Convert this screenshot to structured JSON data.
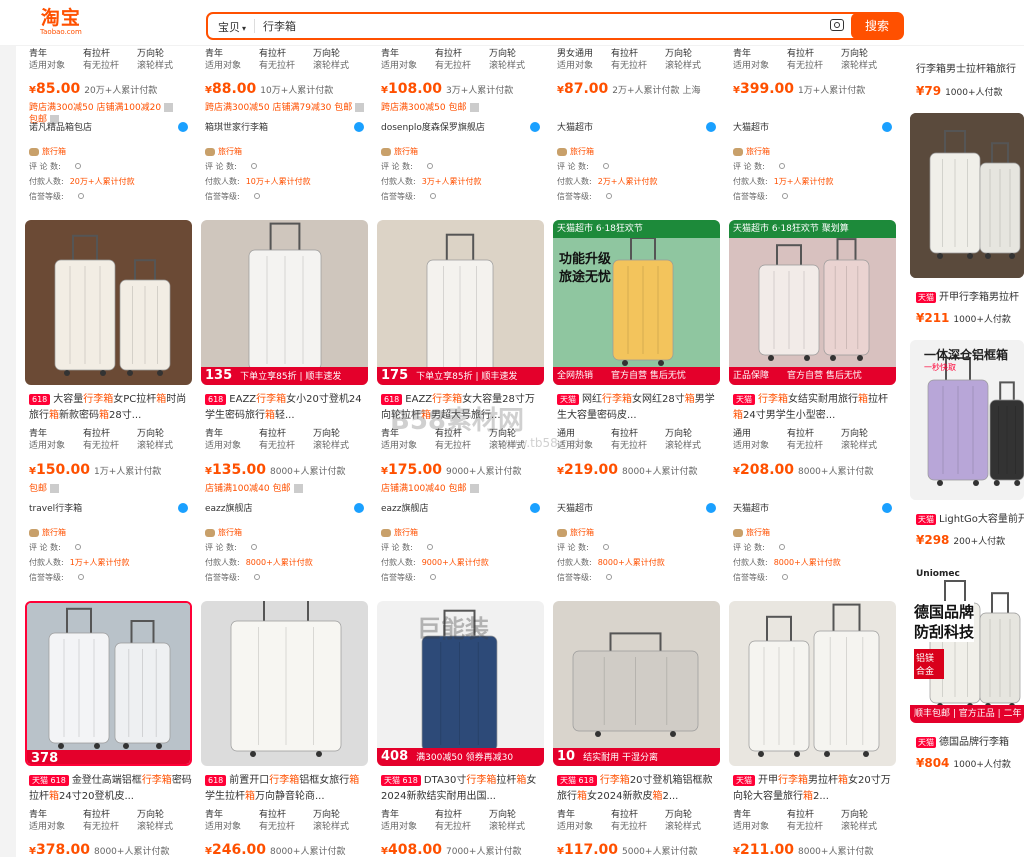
{
  "header": {
    "logo_cn": "淘宝",
    "logo_en": "Taobao.com",
    "scope": "宝贝",
    "query": "行李箱",
    "search_button": "搜索"
  },
  "labels": {
    "comments": "评 论 数:",
    "payers": "付款人数:",
    "credit": "信誉等级:",
    "travel_tag": "旅行箱"
  },
  "row1": [
    {
      "attrs": [
        "青年",
        "有拉杆",
        "万向轮"
      ],
      "keys": [
        "适用对象",
        "有无拉杆",
        "滚轮样式"
      ],
      "price": "85.00",
      "sales": "20万+人累计付款",
      "coupon": "跨店满300减50 店铺满100减20",
      "coupon2": "包邮",
      "shop": "诺凡精品箱包店",
      "payers": "20万+人累计付款"
    },
    {
      "attrs": [
        "青年",
        "有拉杆",
        "万向轮"
      ],
      "keys": [
        "适用对象",
        "有无拉杆",
        "滚轮样式"
      ],
      "price": "88.00",
      "sales": "10万+人累计付款",
      "coupon": "跨店满300减50 店铺满79减30 包邮",
      "coupon2": "",
      "shop": "箱琪世家行李箱",
      "payers": "10万+人累计付款"
    },
    {
      "attrs": [
        "青年",
        "有拉杆",
        "万向轮"
      ],
      "keys": [
        "适用对象",
        "有无拉杆",
        "滚轮样式"
      ],
      "price": "108.00",
      "sales": "3万+人累计付款",
      "coupon": "跨店满300减50 包邮",
      "coupon2": "",
      "shop": "dosenplo度森保罗旗舰店",
      "payers": "3万+人累计付款"
    },
    {
      "attrs": [
        "男女通用",
        "有拉杆",
        "万向轮"
      ],
      "keys": [
        "适用对象",
        "有无拉杆",
        "滚轮样式"
      ],
      "price": "87.00",
      "sales": "2万+人累计付款",
      "loc": "上海",
      "coupon": "",
      "coupon2": "",
      "shop": "大猫超市",
      "payers": "2万+人累计付款"
    },
    {
      "attrs": [
        "青年",
        "有拉杆",
        "万向轮"
      ],
      "keys": [
        "适用对象",
        "有无拉杆",
        "滚轮样式"
      ],
      "price": "399.00",
      "sales": "1万+人累计付款",
      "coupon": "",
      "coupon2": "",
      "shop": "大猫超市",
      "payers": "1万+人累计付款"
    }
  ],
  "row2": [
    {
      "badge": "618",
      "title_parts": [
        "大容量",
        "行李箱",
        "女PC拉杆",
        "箱",
        "时尚旅行",
        "箱",
        "新款密码",
        "箱",
        "28寸..."
      ],
      "attrs": [
        "青年",
        "有拉杆",
        "万向轮"
      ],
      "keys": [
        "适用对象",
        "有无拉杆",
        "滚轮样式"
      ],
      "price": "150.00",
      "sales": "1万+人累计付款",
      "coupon": "包邮",
      "shop": "travel行李箱",
      "payers": "1万+人累计付款"
    },
    {
      "badge": "618",
      "title_parts": [
        "EAZZ",
        "行李箱",
        "女小20寸登机24学生密码旅行",
        "箱",
        "轻..."
      ],
      "attrs": [
        "青年",
        "有拉杆",
        "万向轮"
      ],
      "keys": [
        "适用对象",
        "有无拉杆",
        "滚轮样式"
      ],
      "price": "135.00",
      "sales": "8000+人累计付款",
      "coupon": "店铺满100减40 包邮",
      "shop": "eazz旗舰店",
      "payers": "8000+人累计付款",
      "promo_price": "135",
      "promo_text": "下单立享85折 | 顺丰速发"
    },
    {
      "badge": "618",
      "title_parts": [
        "EAZZ",
        "行李箱",
        "女大容量28寸万向轮拉杆",
        "箱",
        "男超大号旅行..."
      ],
      "attrs": [
        "青年",
        "有拉杆",
        "万向轮"
      ],
      "keys": [
        "适用对象",
        "有无拉杆",
        "滚轮样式"
      ],
      "price": "175.00",
      "sales": "9000+人累计付款",
      "coupon": "店铺满100减40 包邮",
      "shop": "eazz旗舰店",
      "payers": "9000+人累计付款",
      "promo_price": "175",
      "promo_text": "下单立享85折 | 顺丰速发"
    },
    {
      "badge": "天猫",
      "title_parts": [
        "网红",
        "行李箱",
        "女网红28寸",
        "箱",
        "男学生大容量密码皮..."
      ],
      "attrs": [
        "通用",
        "有拉杆",
        "万向轮"
      ],
      "keys": [
        "适用对象",
        "有无拉杆",
        "滚轮样式"
      ],
      "price": "219.00",
      "sales": "8000+人累计付款",
      "coupon": "",
      "shop": "天猫超市",
      "payers": "8000+人累计付款",
      "banner": "天猫超市 6·18狂欢节",
      "promo1": "功能升级",
      "promo2": "旅途无忧",
      "promo3": "全网热销",
      "promo4": "官方自营 售后无忧"
    },
    {
      "badge": "天猫",
      "title_parts": [
        "行李箱",
        "女结实耐用旅行",
        "箱",
        "拉杆",
        "箱",
        "24寸男学生小型密..."
      ],
      "attrs": [
        "通用",
        "有拉杆",
        "万向轮"
      ],
      "keys": [
        "适用对象",
        "有无拉杆",
        "滚轮样式"
      ],
      "price": "208.00",
      "sales": "8000+人累计付款",
      "coupon": "",
      "shop": "天猫超市",
      "payers": "8000+人累计付款",
      "banner": "天猫超市 6·18狂欢节 聚划算",
      "promo3": "正品保障",
      "promo4": "官方自营 售后无忧"
    }
  ],
  "row3": [
    {
      "badge": "天猫 618",
      "title_parts": [
        "金登仕高端铝框",
        "行李箱",
        "密码拉杆",
        "箱",
        "24寸20登机皮..."
      ],
      "attrs": [
        "青年",
        "有拉杆",
        "万向轮"
      ],
      "keys": [
        "适用对象",
        "有无拉杆",
        "滚轮样式"
      ],
      "price": "378.00",
      "sales": "8000+人累计付款",
      "promo": "378"
    },
    {
      "badge": "618",
      "title_parts": [
        "前置开口",
        "行李箱",
        "铝框女旅行",
        "箱",
        "学生拉杆",
        "箱",
        "万向静音轮商..."
      ],
      "attrs": [
        "青年",
        "有拉杆",
        "万向轮"
      ],
      "keys": [
        "适用对象",
        "有无拉杆",
        "滚轮样式"
      ],
      "price": "246.00",
      "sales": "8000+人累计付款"
    },
    {
      "badge": "天猫 618",
      "title_parts": [
        "DTA30寸",
        "行李箱",
        "拉杆",
        "箱",
        "女2024新款结实耐用出国..."
      ],
      "attrs": [
        "青年",
        "有拉杆",
        "万向轮"
      ],
      "keys": [
        "适用对象",
        "有无拉杆",
        "滚轮样式"
      ],
      "price": "408.00",
      "sales": "7000+人累计付款",
      "big": "巨能装",
      "promo": "408",
      "promo_text": "满300减50 领券再减30"
    },
    {
      "badge": "天猫 618",
      "title_parts": [
        "行李箱",
        "20寸登机箱铝框款旅行",
        "箱",
        "女2024新款皮",
        "箱",
        "2..."
      ],
      "attrs": [
        "青年",
        "有拉杆",
        "万向轮"
      ],
      "keys": [
        "适用对象",
        "有无拉杆",
        "滚轮样式"
      ],
      "price": "117.00",
      "sales": "5000+人累计付款",
      "promo": "10",
      "promo_text": "结实耐用 干湿分离"
    },
    {
      "badge": "天猫",
      "title_parts": [
        "开甲",
        "行李箱",
        "男拉杆",
        "箱",
        "女20寸万向轮大容量旅行",
        "箱",
        "2..."
      ],
      "attrs": [
        "青年",
        "有拉杆",
        "万向轮"
      ],
      "keys": [
        "适用对象",
        "有无拉杆",
        "滚轮样式"
      ],
      "price": "211.00",
      "sales": "8000+人累计付款"
    }
  ],
  "right": [
    {
      "title": "行李箱男士拉杆箱旅行",
      "price": "79",
      "sales": "1000+人付款"
    },
    {
      "title": "开甲行李箱男拉杆",
      "price": "211",
      "sales": "1000+人付款"
    },
    {
      "title": "LightGo大容量前开",
      "price": "298",
      "sales": "200+人付款",
      "banner": "一体深仓铝框箱",
      "sub": "一秒快取"
    },
    {
      "title": "德国品牌行李箱",
      "price": "804",
      "sales": "1000+人付款",
      "brand": "Uniomec",
      "promo1": "德国品牌",
      "promo2": "防刮科技",
      "promo3": "铝镁合金",
      "promo4": "顺丰包邮 | 官方正品 | 二年"
    }
  ],
  "watermark": "B58素材网",
  "watermark_url": "www.tb58.net"
}
